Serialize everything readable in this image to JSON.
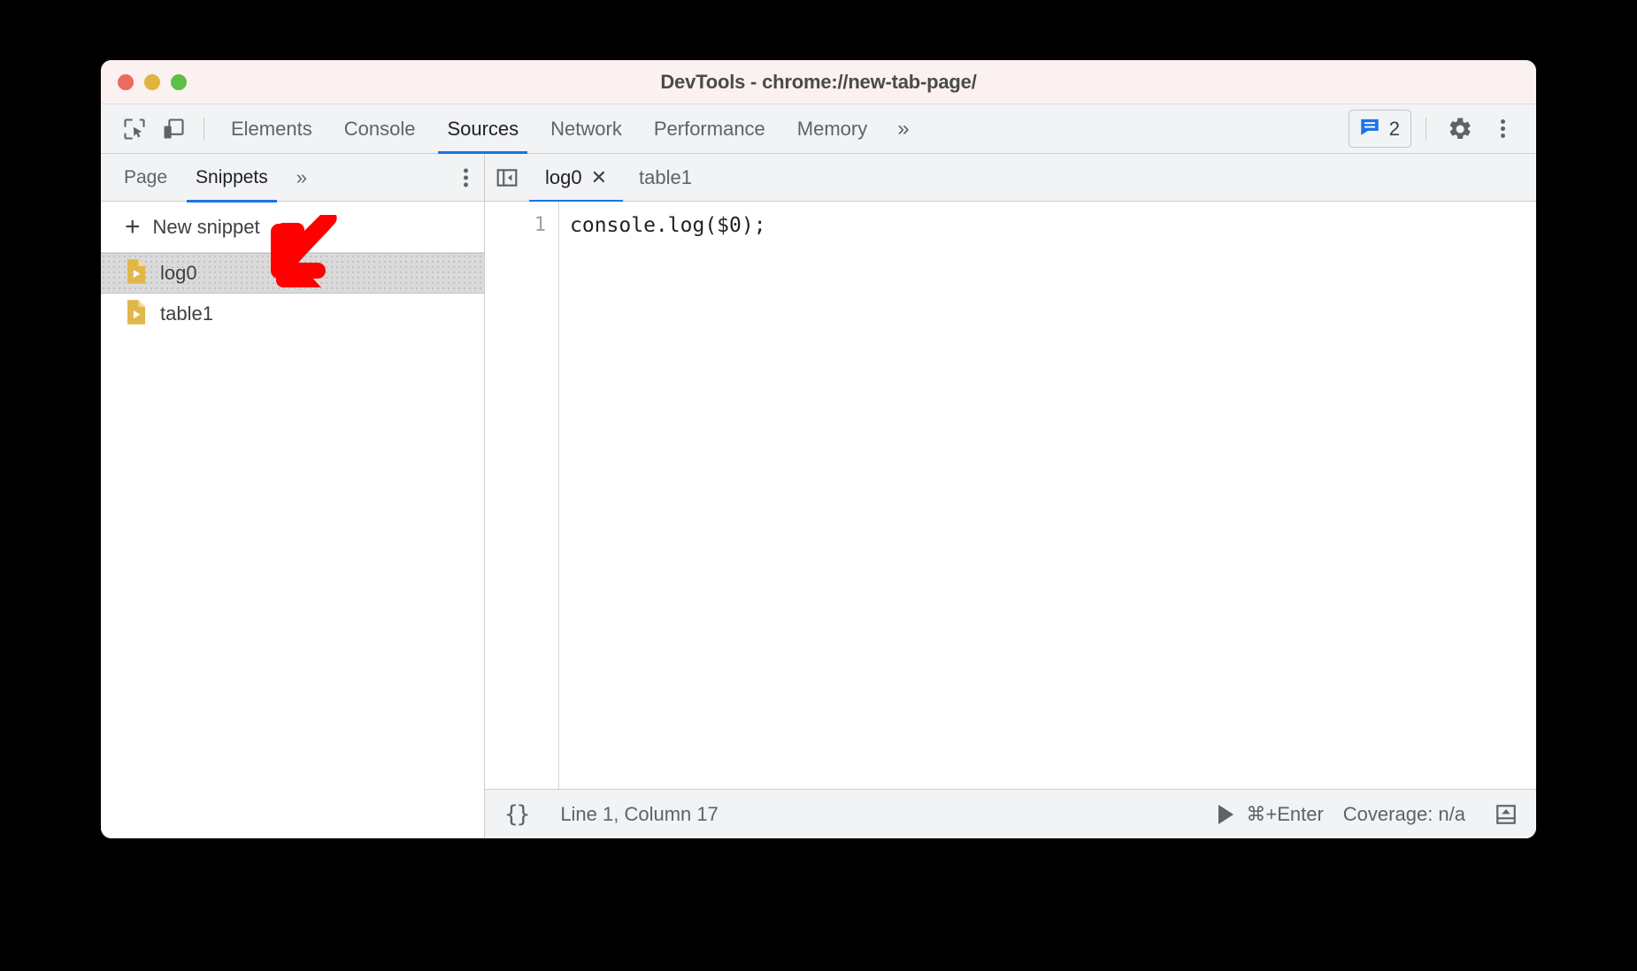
{
  "window": {
    "title": "DevTools - chrome://new-tab-page/",
    "traffic_lights": [
      {
        "name": "close",
        "color": "#ec6a5f"
      },
      {
        "name": "minimize",
        "color": "#e0b43e"
      },
      {
        "name": "maximize",
        "color": "#5cbf46"
      }
    ]
  },
  "toolbar": {
    "inspect_icon": "inspect-element-icon",
    "device_icon": "device-toolbar-icon",
    "panels": [
      {
        "label": "Elements",
        "active": false
      },
      {
        "label": "Console",
        "active": false
      },
      {
        "label": "Sources",
        "active": true
      },
      {
        "label": "Network",
        "active": false
      },
      {
        "label": "Performance",
        "active": false
      },
      {
        "label": "Memory",
        "active": false
      }
    ],
    "more_panels": "»",
    "issues_count": "2",
    "issues_icon": "issues-message-icon",
    "settings_icon": "gear-icon",
    "menu_icon": "kebab-menu-icon",
    "accent_color": "#1a73e8"
  },
  "navigator": {
    "tabs": [
      {
        "label": "Page",
        "active": false
      },
      {
        "label": "Snippets",
        "active": true
      }
    ],
    "more_tabs": "»",
    "kebab": "more-options-icon",
    "new_snippet_label": "New snippet",
    "new_snippet_plus": "+",
    "snippets": [
      {
        "name": "log0",
        "selected": true
      },
      {
        "name": "table1",
        "selected": false
      }
    ]
  },
  "editor": {
    "collapse_icon": "collapse-sidebar-icon",
    "tabs": [
      {
        "label": "log0",
        "active": true,
        "closable": true,
        "close_glyph": "✕"
      },
      {
        "label": "table1",
        "active": false,
        "closable": false,
        "close_glyph": ""
      }
    ],
    "line_numbers": [
      "1"
    ],
    "code": "console.log($0);"
  },
  "status_bar": {
    "format_icon": "{}",
    "cursor_position": "Line 1, Column 17",
    "run_icon": "run-snippet-icon",
    "run_shortcut": "⌘+Enter",
    "coverage": "Coverage: n/a",
    "drawer_icon": "show-drawer-icon"
  },
  "annotation": {
    "arrow": "red-down-left-arrow",
    "color": "#ff0000"
  }
}
